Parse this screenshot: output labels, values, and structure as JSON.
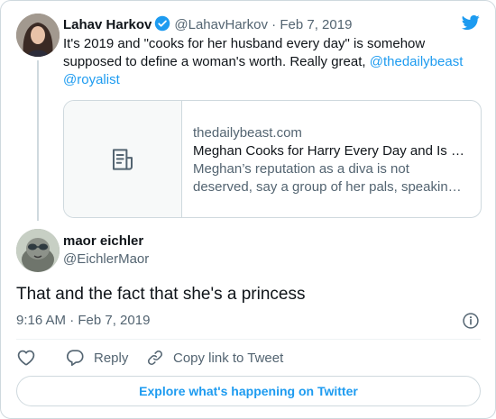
{
  "parent_tweet": {
    "author_name": "Lahav Harkov",
    "author_handle": "@LahavHarkov",
    "separator": "·",
    "date": "Feb 7, 2019",
    "text": "It's 2019 and \"cooks for her husband every day\" is somehow supposed to define a woman's worth. Really great, ",
    "mentions": [
      "@thedailybeast",
      "@royalist"
    ],
    "link_card": {
      "domain": "thedailybeast.com",
      "title": "Meghan Cooks for Harry Every Day and Is Not a Diva",
      "description": "Meghan’s reputation as a diva is not deserved, say a group of her pals, speaking exclusively to People magazine."
    }
  },
  "reply_tweet": {
    "author_name": "maor eichler",
    "author_handle": "@EichlerMaor",
    "text": "That and the fact that she's a princess",
    "timestamp": "9:16 AM · Feb 7, 2019"
  },
  "actions": {
    "reply_label": "Reply",
    "copy_label": "Copy link to Tweet"
  },
  "explore_label": "Explore what's happening on Twitter",
  "icons": {
    "brand": "twitter-bird-icon",
    "verified": "verified-badge-icon",
    "article": "article-icon",
    "info": "info-icon",
    "like": "heart-icon",
    "reply": "reply-bubble-icon",
    "copy": "link-icon"
  },
  "colors": {
    "accent": "#1d9bf0",
    "text": "#0f1419",
    "secondary": "#536471",
    "border": "#cfd9de"
  }
}
